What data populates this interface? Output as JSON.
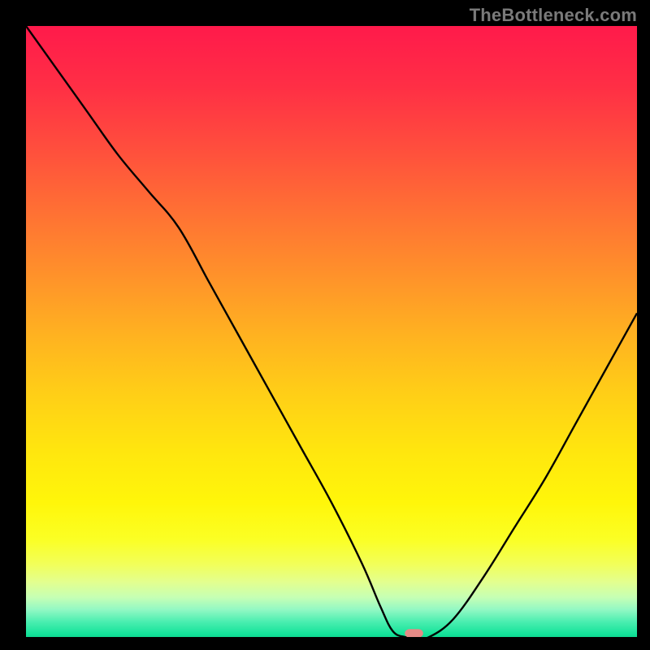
{
  "watermark": "TheBottleneck.com",
  "colors": {
    "curve": "#000000",
    "marker": "#e58a86",
    "page_background": "#000000"
  },
  "gradient_stops": [
    {
      "offset": 0.0,
      "color": "#ff1a4b"
    },
    {
      "offset": 0.1,
      "color": "#ff2f45"
    },
    {
      "offset": 0.2,
      "color": "#ff4e3d"
    },
    {
      "offset": 0.3,
      "color": "#ff6f34"
    },
    {
      "offset": 0.4,
      "color": "#ff8f2b"
    },
    {
      "offset": 0.5,
      "color": "#ffb021"
    },
    {
      "offset": 0.6,
      "color": "#ffce17"
    },
    {
      "offset": 0.7,
      "color": "#ffe70e"
    },
    {
      "offset": 0.78,
      "color": "#fff60a"
    },
    {
      "offset": 0.84,
      "color": "#fbff24"
    },
    {
      "offset": 0.88,
      "color": "#f2ff58"
    },
    {
      "offset": 0.91,
      "color": "#e3ff8f"
    },
    {
      "offset": 0.935,
      "color": "#c6ffb4"
    },
    {
      "offset": 0.955,
      "color": "#93f8c4"
    },
    {
      "offset": 0.975,
      "color": "#4beeb0"
    },
    {
      "offset": 0.995,
      "color": "#14e39a"
    },
    {
      "offset": 1.0,
      "color": "#0fd890"
    }
  ],
  "chart_data": {
    "type": "line",
    "title": "",
    "xlabel": "",
    "ylabel": "",
    "xlim": [
      0,
      100
    ],
    "ylim": [
      0,
      100
    ],
    "grid": false,
    "legend": false,
    "x": [
      0,
      5,
      10,
      15,
      20,
      25,
      30,
      35,
      40,
      45,
      50,
      55,
      58,
      60,
      62,
      64,
      66,
      70,
      75,
      80,
      85,
      90,
      95,
      100
    ],
    "values": [
      100,
      93,
      86,
      79,
      73,
      67,
      58,
      49,
      40,
      31,
      22,
      12,
      5,
      1,
      0,
      0,
      0,
      3,
      10,
      18,
      26,
      35,
      44,
      53
    ],
    "marker": {
      "x": 63.5,
      "y": 0.6,
      "width": 3.0,
      "height": 1.4
    }
  }
}
